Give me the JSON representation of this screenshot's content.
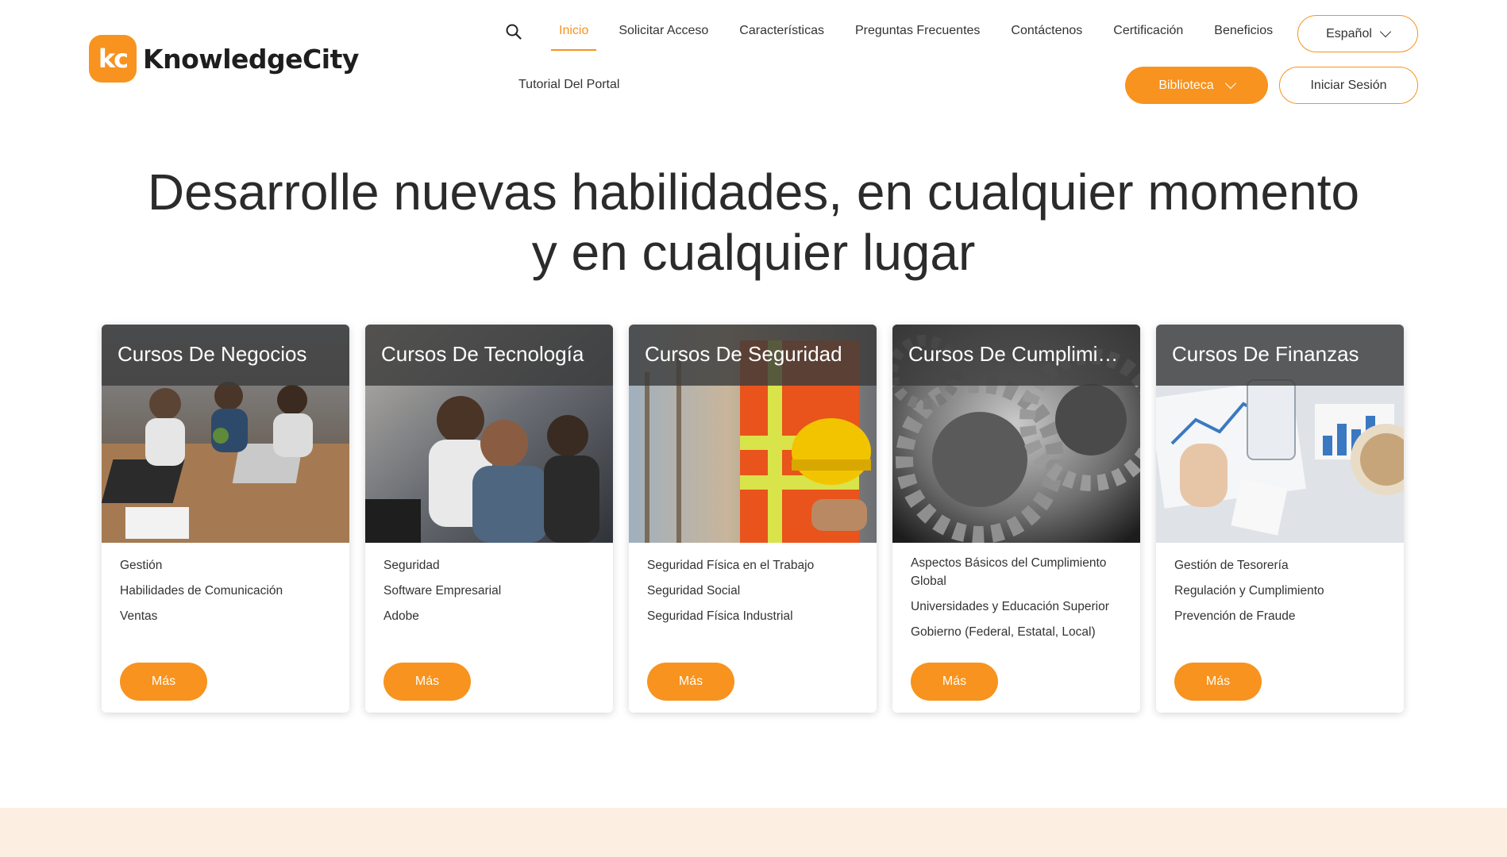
{
  "brand": {
    "logo_mark": "kc",
    "name": "KnowledgeCity",
    "accent": "#f7931e"
  },
  "nav": {
    "items": [
      {
        "label": "Inicio",
        "active": true
      },
      {
        "label": "Solicitar Acceso"
      },
      {
        "label": "Características"
      },
      {
        "label": "Preguntas Frecuentes"
      },
      {
        "label": "Contáctenos"
      },
      {
        "label": "Certificación"
      },
      {
        "label": "Beneficios"
      }
    ],
    "second_row": "Tutorial Del Portal",
    "language": "Español",
    "library": "Biblioteca",
    "login": "Iniciar Sesión",
    "search_icon": "search-icon"
  },
  "hero": {
    "line1": "Desarrolle nuevas habilidades, en cualquier momento",
    "line2": "y en cualquier lugar"
  },
  "cards": [
    {
      "title": "Cursos De Negocios",
      "items": [
        "Gestión",
        "Habilidades de Comunicación",
        "Ventas"
      ],
      "button": "Más"
    },
    {
      "title": "Cursos De Tecnología",
      "items": [
        "Seguridad",
        "Software Empresarial",
        "Adobe"
      ],
      "button": "Más"
    },
    {
      "title": "Cursos De Seguridad",
      "items": [
        "Seguridad Física en el Trabajo",
        "Seguridad Social",
        "Seguridad Física Industrial"
      ],
      "button": "Más"
    },
    {
      "title": "Cursos De Cumplimiento",
      "items": [
        "Aspectos Básicos del Cumplimiento Global",
        "Universidades y Educación Superior",
        "Gobierno (Federal, Estatal, Local)"
      ],
      "button": "Más"
    },
    {
      "title": "Cursos De Finanzas",
      "items": [
        "Gestión de Tesorería",
        "Regulación y Cumplimiento",
        "Prevención de Fraude"
      ],
      "button": "Más"
    }
  ]
}
